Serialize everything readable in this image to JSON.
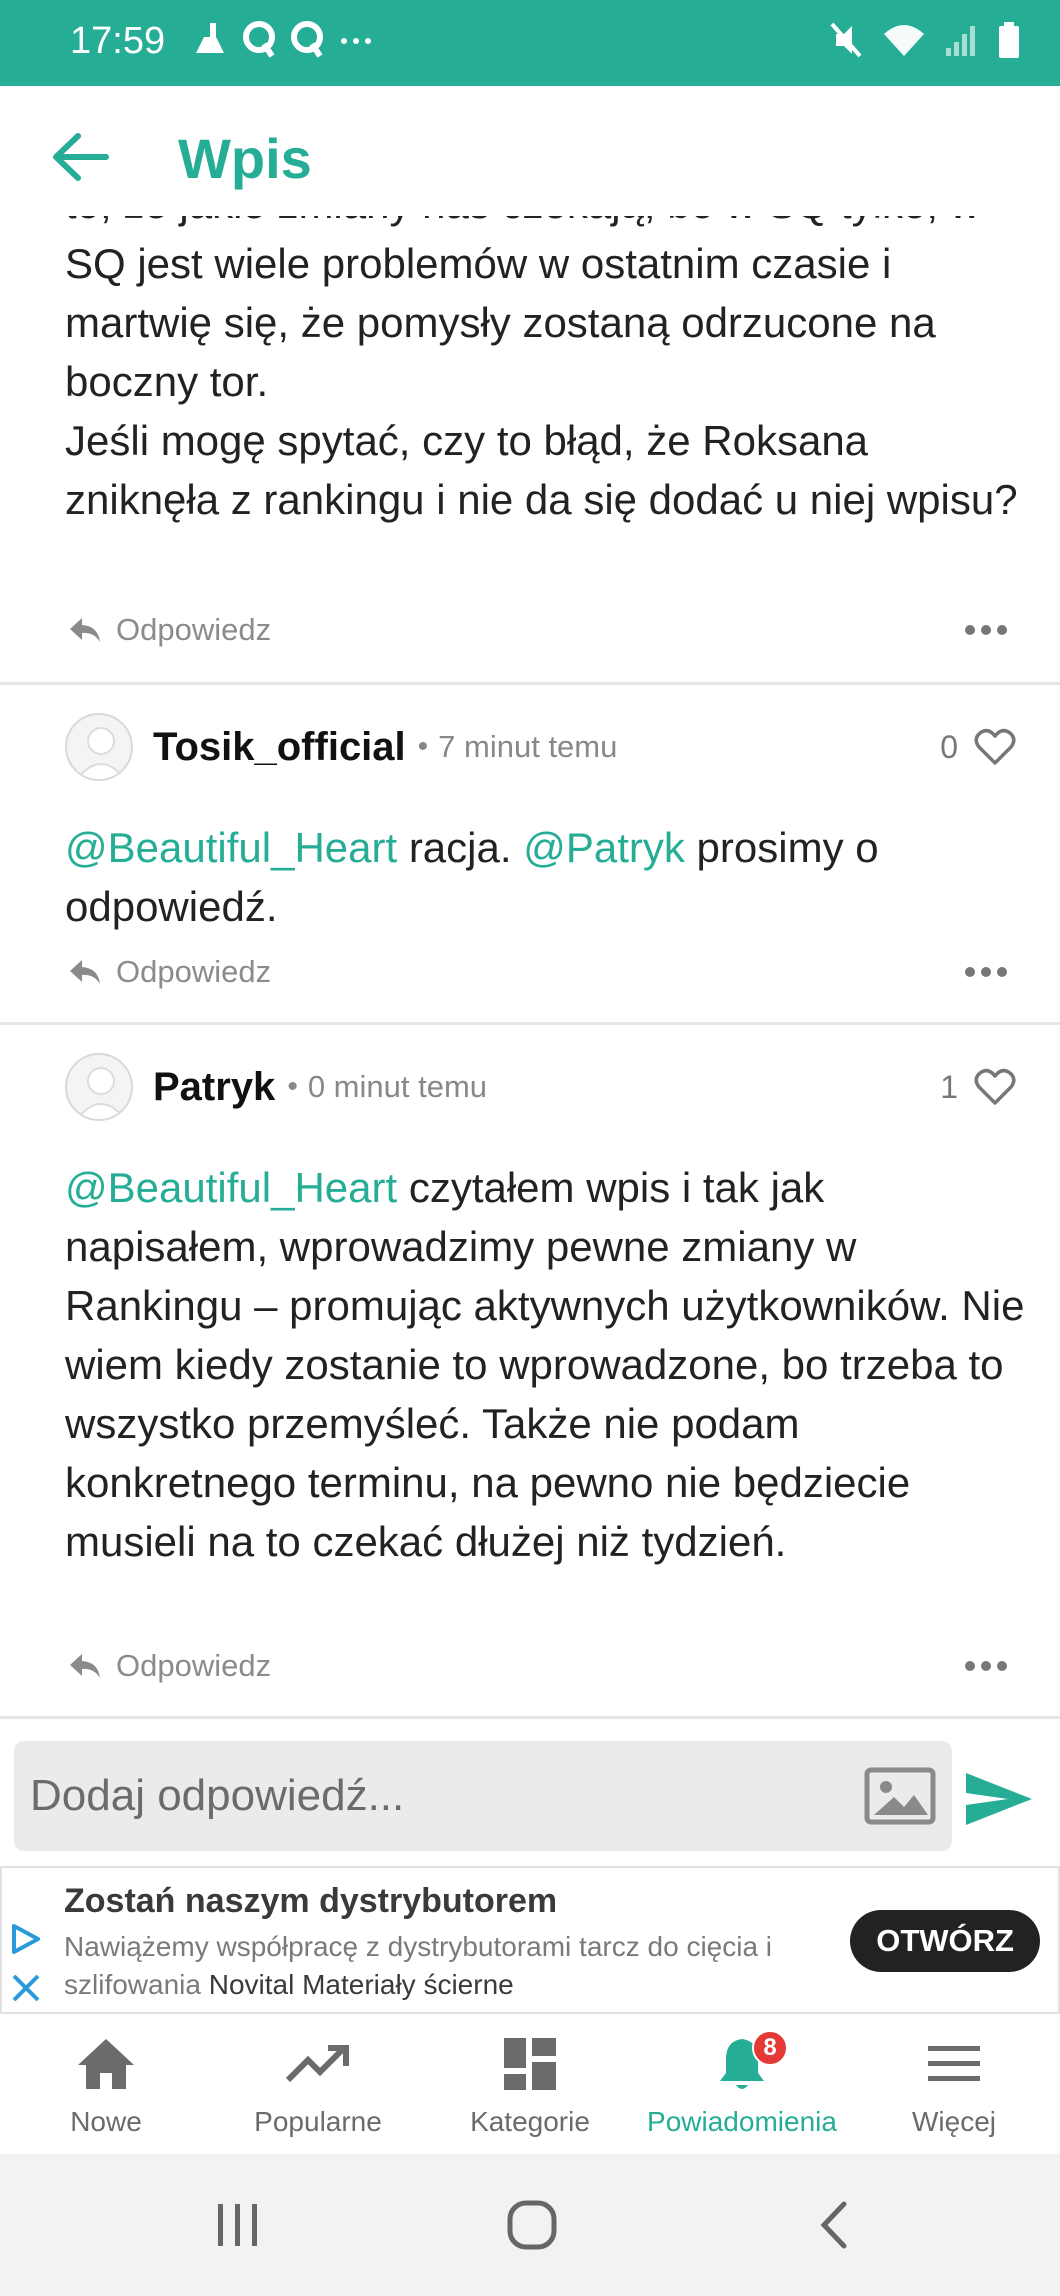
{
  "status_bar": {
    "time": "17:59",
    "icons_left": [
      "cleaner-icon",
      "qq-icon",
      "qq-icon",
      "more-dots-icon"
    ],
    "icons_right": [
      "mute-icon",
      "wifi-icon",
      "signal-icon",
      "battery-icon"
    ],
    "color": "#25ad96"
  },
  "app_bar": {
    "title": "Wpis",
    "back_icon": "arrow-left-icon"
  },
  "first_comment": {
    "cut_text": "to, że jakie zmiany nas czekają, bo w SQ tylko, w",
    "text": "SQ jest wiele problemów w ostatnim czasie i martwię się, że pomysły zostaną odrzucone na boczny tor.\nJeśli mogę spytać, czy to błąd, że Roksana zniknęła z rankingu i nie da się dodać u niej wpisu?",
    "reply_label": "Odpowiedz"
  },
  "comments": [
    {
      "username": "Tosik_official",
      "time": "7 minut temu",
      "likes": "0",
      "mention_1": "@Beautiful_Heart",
      "text_1": " racja. ",
      "mention_2": "@Patryk",
      "text_2": " prosimy o odpowiedź.",
      "reply_label": "Odpowiedz"
    },
    {
      "username": "Patryk",
      "time": "0 minut temu",
      "likes": "1",
      "mention_1": "@Beautiful_Heart",
      "text_1": " czytałem wpis i tak jak napisałem, wprowadzimy pewne zmiany w Rankingu – promując aktywnych użytkowników. Nie wiem kiedy zostanie to wprowadzone, bo trzeba to wszystko przemyśleć. Także nie podam konkretnego terminu, na pewno nie będziecie musieli na to czekać dłużej niż tydzień.",
      "reply_label": "Odpowiedz"
    }
  ],
  "compose": {
    "placeholder": "Dodaj odpowiedź..."
  },
  "ad": {
    "title": "Zostań naszym dystrybutorem",
    "description": "Nawiążemy współpracę z dystrybutorami tarcz do cięcia i szlifowania ",
    "brand": "Novital Materiały ścierne",
    "cta": "OTWÓRZ"
  },
  "bottom_nav": {
    "items": [
      {
        "label": "Nowe",
        "icon": "home-icon"
      },
      {
        "label": "Popularne",
        "icon": "trending-icon"
      },
      {
        "label": "Kategorie",
        "icon": "dashboard-icon"
      },
      {
        "label": "Powiadomienia",
        "icon": "bell-icon",
        "badge": "8",
        "active": true
      },
      {
        "label": "Więcej",
        "icon": "menu-icon"
      }
    ]
  },
  "colors": {
    "accent": "#25ad96",
    "badge": "#e53935"
  }
}
